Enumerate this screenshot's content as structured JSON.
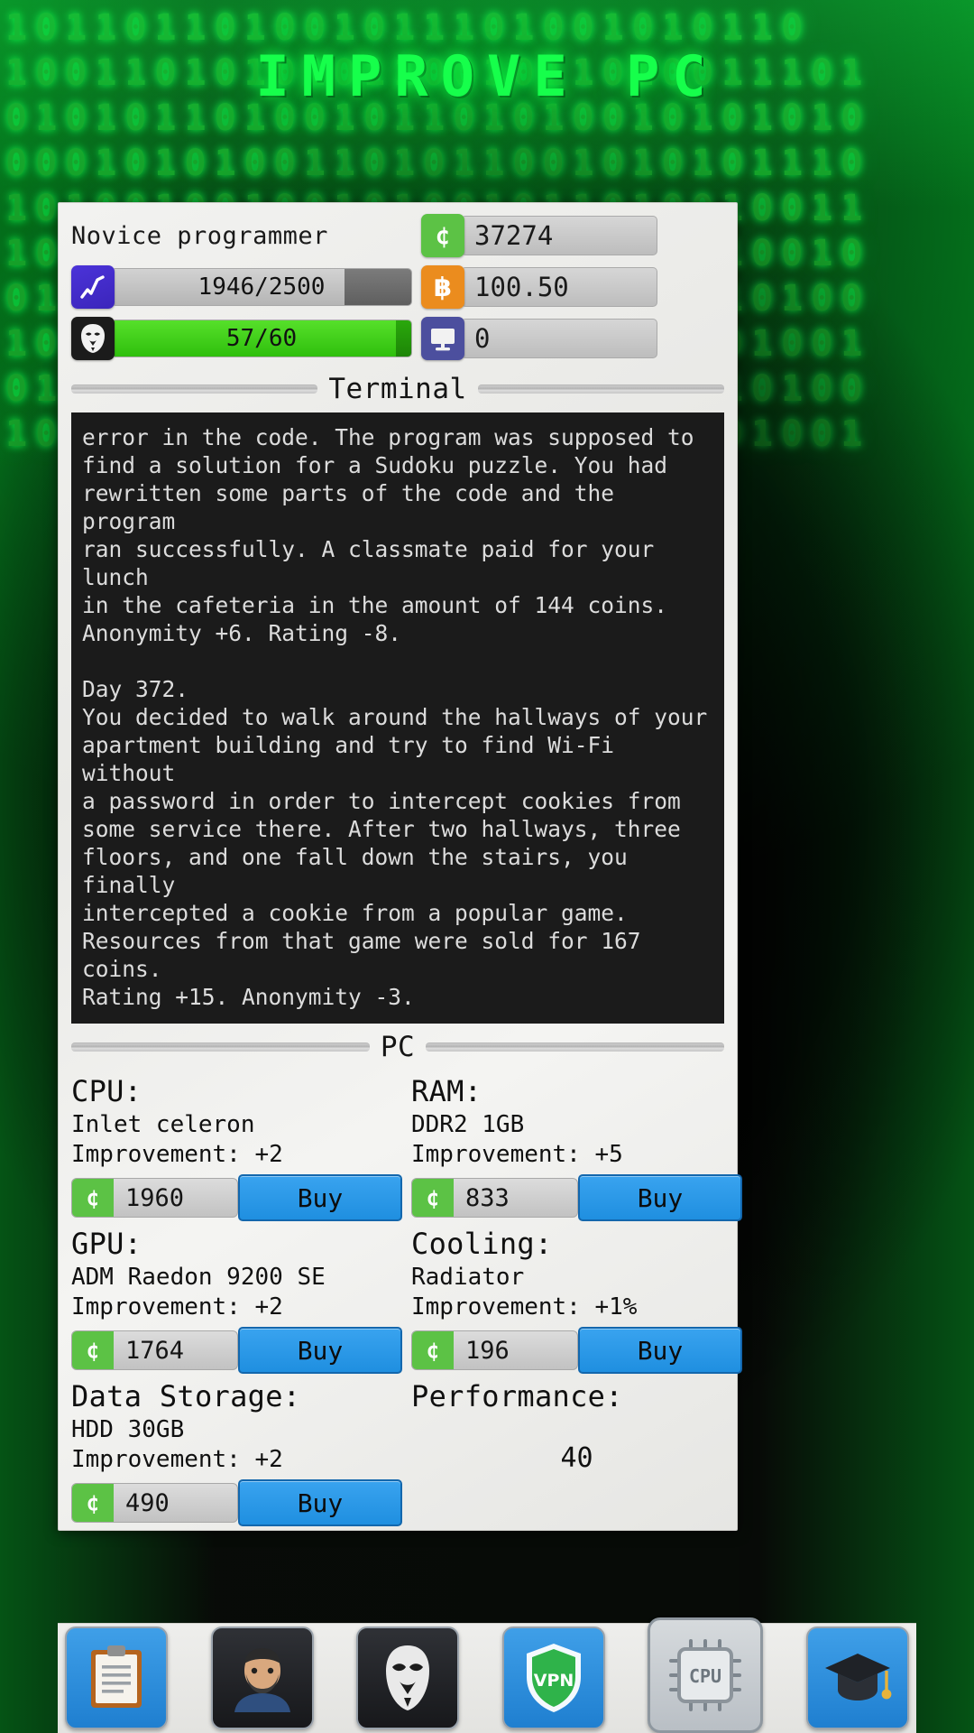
{
  "app": {
    "title": "IMPROVE PC",
    "background_digits": "101101101001011101001010110\n10011010101011001011010011101\n01010110100101101010010101010\n00010101001101011001010101110\n10100100100101001011010010011\n10101001010010100101001010010\n01001010010100101001010010100\n10010100101001010010100101001\n01001010010100101001010010100\n10010100101001010010100101001"
  },
  "header": {
    "rank": "Novice programmer",
    "rating": {
      "icon": "chart-line-icon",
      "value": "1946/2500",
      "current": 1946,
      "max": 2500
    },
    "anonymity": {
      "icon": "anonymous-mask-icon",
      "value": "57/60",
      "current": 57,
      "max": 60
    },
    "coins": {
      "icon": "coin-icon",
      "value": "37274"
    },
    "bitcoin": {
      "icon": "bitcoin-icon",
      "value": "100.50"
    },
    "computers": {
      "icon": "monitor-icon",
      "value": "0"
    }
  },
  "terminal": {
    "section_label": "Terminal",
    "text": "error in the code. The program was supposed to\nfind a solution for a Sudoku puzzle. You had\nrewritten some parts of the code and the program\nran successfully. A classmate paid for your lunch\nin the cafeteria in the amount of 144 coins.\nAnonymity +6. Rating -8.\n\nDay 372.\nYou decided to walk around the hallways of your\napartment building and try to find Wi-Fi without\na password in order to intercept cookies from\nsome service there. After two hallways, three\nfloors, and one fall down the stairs, you finally\nintercepted a cookie from a popular game.\nResources from that game were sold for 167 coins.\nRating +15. Anonymity -3."
  },
  "pc": {
    "section_label": "PC",
    "buy_label": "Buy",
    "components": [
      {
        "name": "CPU:",
        "model": "Inlet celeron",
        "improvement": "Improvement: +2",
        "price": "1960"
      },
      {
        "name": "RAM:",
        "model": "DDR2 1GB",
        "improvement": "Improvement: +5",
        "price": "833"
      },
      {
        "name": "GPU:",
        "model": "ADM Raedon 9200 SE",
        "improvement": "Improvement: +2",
        "price": "1764"
      },
      {
        "name": "Cooling:",
        "model": "Radiator",
        "improvement": "Improvement: +1%",
        "price": "196"
      },
      {
        "name": "Data Storage:",
        "model": "HDD 30GB",
        "improvement": "Improvement: +2",
        "price": "490"
      }
    ],
    "performance": {
      "label": "Performance:",
      "value": "40"
    }
  },
  "nav": {
    "items": [
      {
        "id": "tasks",
        "icon": "clipboard-icon",
        "style": "blue"
      },
      {
        "id": "profile",
        "icon": "person-icon",
        "style": "dark"
      },
      {
        "id": "anonymity",
        "icon": "anonymous-mask-icon",
        "style": "dark"
      },
      {
        "id": "vpn",
        "icon": "shield-vpn-icon",
        "label": "VPN",
        "style": "blue"
      },
      {
        "id": "pc",
        "icon": "cpu-icon",
        "label": "CPU",
        "style": "selected"
      },
      {
        "id": "education",
        "icon": "graduation-cap-icon",
        "style": "blue"
      }
    ]
  },
  "colors": {
    "brand_green": "#16ff4b",
    "coin_green": "#5cc245",
    "bitcoin_orange": "#eb8c1e",
    "buy_blue": "#1f8fe0",
    "rating_purple": "#4b33d8",
    "pc_indigo": "#4c4f9e"
  }
}
